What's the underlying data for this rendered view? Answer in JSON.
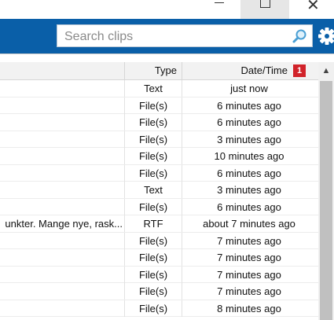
{
  "window": {
    "minimize_icon": "minimize-icon",
    "maximize_icon": "maximize-icon",
    "close_glyph": "✕"
  },
  "toolbar": {
    "accent_color": "#0a5fa8",
    "search_placeholder": "Search clips",
    "search_value": ""
  },
  "table": {
    "columns": {
      "type": "Type",
      "date": "Date/Time"
    },
    "sort_badge": "1",
    "rows": [
      {
        "clip": "",
        "type": "Text",
        "date": "just now"
      },
      {
        "clip": "",
        "type": "File(s)",
        "date": "6 minutes ago"
      },
      {
        "clip": "",
        "type": "File(s)",
        "date": "6 minutes ago"
      },
      {
        "clip": "",
        "type": "File(s)",
        "date": "3 minutes ago"
      },
      {
        "clip": "",
        "type": "File(s)",
        "date": "10 minutes ago"
      },
      {
        "clip": "",
        "type": "File(s)",
        "date": "6 minutes ago"
      },
      {
        "clip": "",
        "type": "Text",
        "date": "3 minutes ago"
      },
      {
        "clip": "",
        "type": "File(s)",
        "date": "6 minutes ago"
      },
      {
        "clip": "unkter. Mange nye, rask...",
        "type": "RTF",
        "date": "about 7 minutes ago"
      },
      {
        "clip": "",
        "type": "File(s)",
        "date": "7 minutes ago"
      },
      {
        "clip": "",
        "type": "File(s)",
        "date": "7 minutes ago"
      },
      {
        "clip": "",
        "type": "File(s)",
        "date": "7 minutes ago"
      },
      {
        "clip": "",
        "type": "File(s)",
        "date": "7 minutes ago"
      },
      {
        "clip": "",
        "type": "File(s)",
        "date": "8 minutes ago"
      }
    ]
  }
}
